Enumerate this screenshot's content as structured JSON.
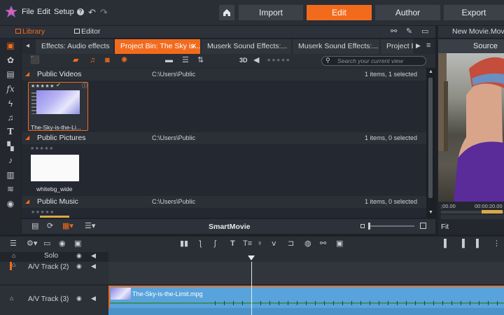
{
  "menu": {
    "file": "File",
    "edit": "Edit",
    "setup": "Setup"
  },
  "nav": {
    "import": "Import",
    "edit": "Edit",
    "author": "Author",
    "export": "Export"
  },
  "library_header": {
    "library": "Library",
    "editor": "Editor",
    "project_name": "New Movie.Movie",
    "source": "Source"
  },
  "tabs": [
    {
      "label": "Effects: Audio effects"
    },
    {
      "label": "Project Bin: The Sky is..."
    },
    {
      "label": "Muserk Sound Effects:..."
    },
    {
      "label": "Muserk Sound Effects:..."
    },
    {
      "label": "Project B"
    }
  ],
  "toolbar": {
    "view_3d": "3D",
    "search_placeholder": "Search your current view"
  },
  "sections": {
    "videos": {
      "title": "Public Videos",
      "path": "C:\\Users\\Public",
      "count": "1 items, 1 selected",
      "item": "The-Sky-is-the-Li..."
    },
    "pictures": {
      "title": "Public Pictures",
      "path": "C:\\Users\\Public",
      "count": "1 items, 0 selected",
      "item": "whitebg_wide"
    },
    "music": {
      "title": "Public Music",
      "path": "C:\\Users\\Public",
      "count": "1 items, 0 selected"
    }
  },
  "smartmovie": "SmartMovie",
  "source_panel": {
    "tc1": ";00.00",
    "tc2": "00:00:20.00",
    "fit": "Fit"
  },
  "tracks": {
    "solo": "Solo",
    "track2": "A/V Track (2)",
    "track3": "A/V Track (3)",
    "clip": "The-Sky-is-the-Limit.mpg"
  },
  "colors": {
    "accent": "#f26b1d",
    "clip": "#58a3dc",
    "bg": "#1e2228"
  }
}
